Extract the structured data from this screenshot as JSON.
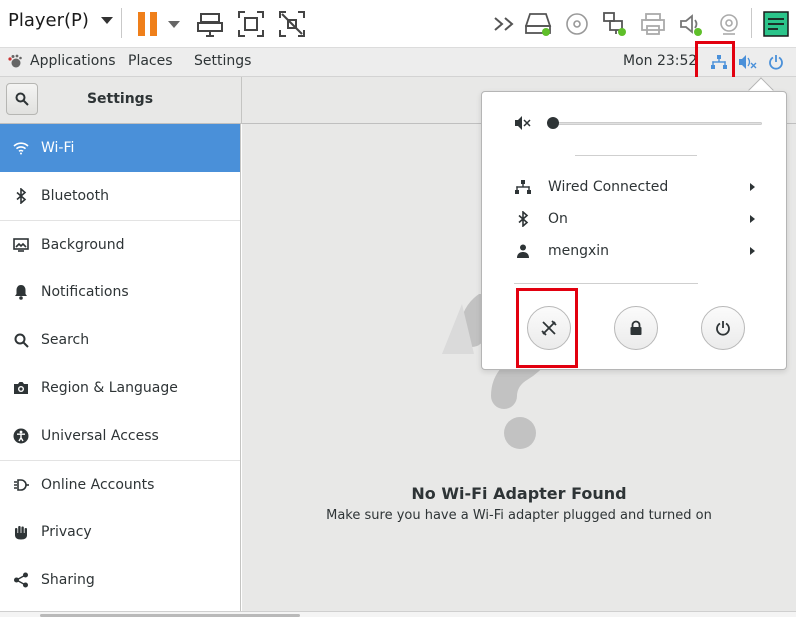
{
  "player": {
    "menu_label": "Player(P)",
    "icons": [
      "pause-icon",
      "send-keys-icon",
      "fit-window-icon",
      "unity-icon",
      "forward-icon",
      "hard-disk-icon",
      "cd-icon",
      "network-adapter-icon",
      "printer-icon",
      "sound-icon",
      "camera-icon",
      "notes-icon"
    ]
  },
  "topbar": {
    "applications": "Applications",
    "places": "Places",
    "settings": "Settings",
    "clock": "Mon 23:52"
  },
  "header": {
    "title": "Settings"
  },
  "sidebar": {
    "items": [
      {
        "label": "Wi-Fi",
        "icon": "wifi-icon"
      },
      {
        "label": "Bluetooth",
        "icon": "bluetooth-icon"
      },
      {
        "label": "Background",
        "icon": "background-icon"
      },
      {
        "label": "Notifications",
        "icon": "bell-icon"
      },
      {
        "label": "Search",
        "icon": "search-icon"
      },
      {
        "label": "Region & Language",
        "icon": "camera-icon"
      },
      {
        "label": "Universal Access",
        "icon": "accessibility-icon"
      },
      {
        "label": "Online Accounts",
        "icon": "online-accounts-icon"
      },
      {
        "label": "Privacy",
        "icon": "hand-icon"
      },
      {
        "label": "Sharing",
        "icon": "share-icon"
      }
    ]
  },
  "main": {
    "empty_title": "No Wi-Fi Adapter Found",
    "empty_subtitle": "Make sure you have a Wi-Fi adapter plugged and turned on"
  },
  "popover": {
    "volume_level": 0.0,
    "rows": [
      {
        "label": "Wired Connected",
        "icon": "network-icon"
      },
      {
        "label": "On",
        "icon": "bluetooth-icon"
      },
      {
        "label": "mengxin",
        "icon": "user-icon"
      }
    ],
    "buttons": [
      "settings-icon",
      "lock-icon",
      "power-icon"
    ]
  },
  "colors": {
    "accent": "#4a90d9",
    "highlight": "#e2000f",
    "pause": "#ef7f1a",
    "status_green": "#5fbf2a"
  }
}
